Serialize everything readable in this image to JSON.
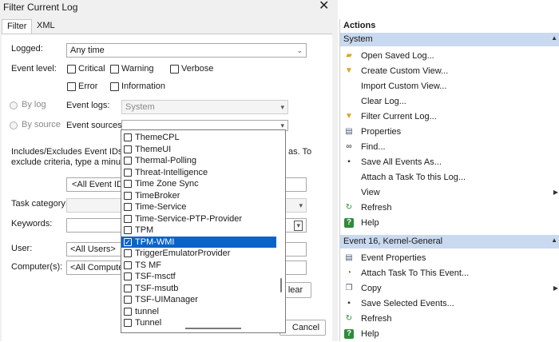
{
  "dialog": {
    "title": "Filter Current Log",
    "close_glyph": "✕",
    "tabs": [
      {
        "label": "Filter"
      },
      {
        "label": "XML"
      }
    ],
    "logged": {
      "label": "Logged:",
      "value": "Any time"
    },
    "event_level": {
      "label": "Event level:",
      "options": [
        "Critical",
        "Warning",
        "Verbose",
        "Error",
        "Information"
      ]
    },
    "by_log": {
      "label": "By log",
      "field_label": "Event logs:",
      "value": "System"
    },
    "by_source": {
      "label": "By source",
      "field_label": "Event sources:"
    },
    "includes_text_1": "Includes/Excludes Event IDs: Enter",
    "includes_text_1_end": "as. To",
    "includes_text_2": "exclude criteria, type a minus sign",
    "event_ids": {
      "value": "<All Event IDs>"
    },
    "task_category": {
      "label": "Task category:"
    },
    "keywords": {
      "label": "Keywords:"
    },
    "user": {
      "label": "User:",
      "value": "<All Users>"
    },
    "computers": {
      "label": "Computer(s):",
      "value": "<All Computers"
    },
    "clear_button": "lear",
    "cancel_button": "Cancel"
  },
  "event_sources_dropdown": {
    "items": [
      {
        "label": "ThemeCPL",
        "checked": false
      },
      {
        "label": "ThemeUI",
        "checked": false
      },
      {
        "label": "Thermal-Polling",
        "checked": false
      },
      {
        "label": "Threat-Intelligence",
        "checked": false
      },
      {
        "label": "Time Zone Sync",
        "checked": false
      },
      {
        "label": "TimeBroker",
        "checked": false
      },
      {
        "label": "Time-Service",
        "checked": false
      },
      {
        "label": "Time-Service-PTP-Provider",
        "checked": false
      },
      {
        "label": "TPM",
        "checked": false
      },
      {
        "label": "TPM-WMI",
        "checked": true
      },
      {
        "label": "TriggerEmulatorProvider",
        "checked": false
      },
      {
        "label": "TS MF",
        "checked": false
      },
      {
        "label": "TSF-msctf",
        "checked": false
      },
      {
        "label": "TSF-msutb",
        "checked": false
      },
      {
        "label": "TSF-UIManager",
        "checked": false
      },
      {
        "label": "tunnel",
        "checked": false
      },
      {
        "label": "Tunnel",
        "checked": false
      }
    ]
  },
  "actions": {
    "title": "Actions",
    "sections": [
      {
        "header": "System",
        "items": [
          {
            "label": "Open Saved Log...",
            "icon": "folder-icon"
          },
          {
            "label": "Create Custom View...",
            "icon": "filter-icon"
          },
          {
            "label": "Import Custom View...",
            "icon": ""
          },
          {
            "label": "Clear Log...",
            "icon": ""
          },
          {
            "label": "Filter Current Log...",
            "icon": "filter-icon"
          },
          {
            "label": "Properties",
            "icon": "properties-icon"
          },
          {
            "label": "Find...",
            "icon": "binoculars-icon"
          },
          {
            "label": "Save All Events As...",
            "icon": "save-icon"
          },
          {
            "label": "Attach a Task To this Log...",
            "icon": ""
          },
          {
            "label": "View",
            "icon": "",
            "submenu": true
          },
          {
            "label": "Refresh",
            "icon": "refresh-icon"
          },
          {
            "label": "Help",
            "icon": "help-icon"
          }
        ]
      },
      {
        "header": "Event 16, Kernel-General",
        "items": [
          {
            "label": "Event Properties",
            "icon": "properties-icon"
          },
          {
            "label": "Attach Task To This Event...",
            "icon": "task-icon"
          },
          {
            "label": "Copy",
            "icon": "copy-icon",
            "submenu": true
          },
          {
            "label": "Save Selected Events...",
            "icon": "save-icon"
          },
          {
            "label": "Refresh",
            "icon": "refresh-icon"
          },
          {
            "label": "Help",
            "icon": "help-icon"
          }
        ]
      }
    ]
  },
  "colors": {
    "section_header_bg": "#c9d9ef",
    "selection": "#0a64c8"
  }
}
